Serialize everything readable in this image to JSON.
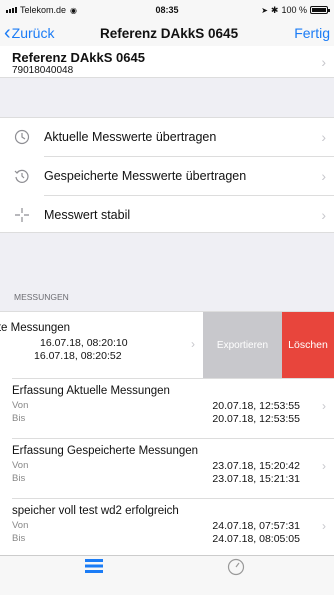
{
  "status_bar": {
    "carrier": "Telekom.de",
    "time": "08:35",
    "battery": "100 %"
  },
  "nav": {
    "back_label": "Zurück",
    "title": "Referenz DAkkS 0645",
    "done_label": "Fertig"
  },
  "device": {
    "name": "Referenz DAkkS 0645",
    "serial": "79018040048"
  },
  "actions": [
    {
      "label": "Aktuelle Messwerte übertragen",
      "icon": "clock-icon"
    },
    {
      "label": "Gespeicherte Messwerte übertragen",
      "icon": "history-icon"
    },
    {
      "label": "Messwert stabil",
      "icon": "crosshair-icon"
    }
  ],
  "section": {
    "title": "MESSUNGEN"
  },
  "swiped_row": {
    "name": "rte Messungen",
    "date1": "16.07.18, 08:20:10",
    "date2": "16.07.18, 08:20:52",
    "export_label": "Exportieren",
    "delete_label": "Löschen"
  },
  "measurements": [
    {
      "name": "Erfassung Aktuelle Messungen",
      "von_label": "Von",
      "von": "20.07.18, 12:53:55",
      "bis_label": "Bis",
      "bis": "20.07.18, 12:53:55"
    },
    {
      "name": "Erfassung Gespeicherte Messungen",
      "von_label": "Von",
      "von": "23.07.18, 15:20:42",
      "bis_label": "Bis",
      "bis": "23.07.18, 15:21:31"
    },
    {
      "name": "speicher voll test wd2 erfolgreich",
      "von_label": "Von",
      "von": "24.07.18, 07:57:31",
      "bis_label": "Bis",
      "bis": "24.07.18, 08:05:05"
    }
  ],
  "tabs": [
    {
      "label": "",
      "icon": "list-icon",
      "color": "#1b7cf6"
    },
    {
      "label": "",
      "icon": "gauge-icon",
      "color": "#999999"
    }
  ]
}
